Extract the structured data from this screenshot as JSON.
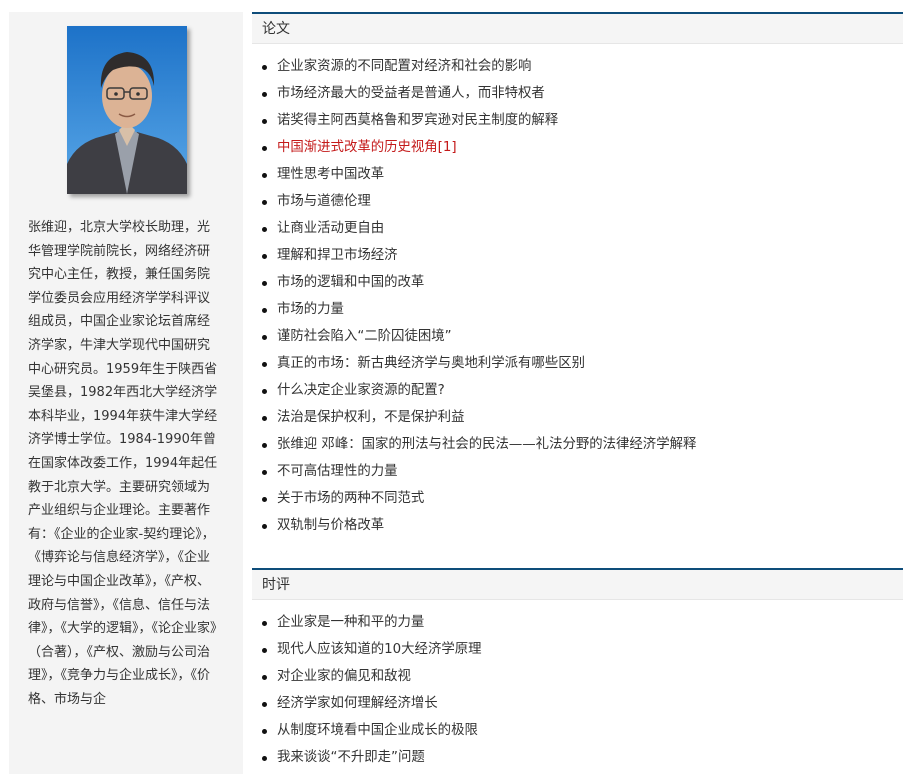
{
  "profile": {
    "portrait_alt": "张维迎",
    "bio": "张维迎，北京大学校长助理，光华管理学院前院长，网络经济研究中心主任，教授，兼任国务院学位委员会应用经济学学科评议组成员，中国企业家论坛首席经济学家，牛津大学现代中国研究中心研究员。1959年生于陕西省吴堡县，1982年西北大学经济学本科毕业，1994年获牛津大学经济学博士学位。1984-1990年曾在国家体改委工作，1994年起任教于北京大学。主要研究领域为产业组织与企业理论。主要著作有：《企业的企业家-契约理论》，《博弈论与信息经济学》，《企业理论与中国企业改革》，《产权、政府与信誉》，《信息、信任与法律》，《大学的逻辑》，《论企业家》（合著），《产权、激励与公司治理》，《竞争力与企业成长》，《价格、市场与企"
  },
  "papers": {
    "title": "论文",
    "items": [
      "企业家资源的不同配置对经济和社会的影响",
      "市场经济最大的受益者是普通人，而非特权者",
      "诺奖得主阿西莫格鲁和罗宾逊对民主制度的解释",
      "中国渐进式改革的历史视角[1]",
      "理性思考中国改革",
      "市场与道德伦理",
      "让商业活动更自由",
      "理解和捍卫市场经济",
      "市场的逻辑和中国的改革",
      "市场的力量",
      "谨防社会陷入“二阶囚徒困境”",
      "真正的市场：新古典经济学与奥地利学派有哪些区别",
      "什么决定企业家资源的配置?",
      "法治是保护权利，不是保护利益",
      "张维迎 邓峰：国家的刑法与社会的民法——礼法分野的法律经济学解释",
      "不可高估理性的力量",
      "关于市场的两种不同范式",
      "双轨制与价格改革"
    ]
  },
  "commentary": {
    "title": "时评",
    "items": [
      "企业家是一种和平的力量",
      "现代人应该知道的10大经济学原理",
      "对企业家的偏见和敌视",
      "经济学家如何理解经济增长",
      "从制度环境看中国企业成长的极限",
      "我来谈谈“不升即走”问题"
    ]
  },
  "colors": {
    "header_border": "#0e4d7a",
    "highlight_link": "#c41a1a",
    "sidebar_bg": "#f4f4f4"
  }
}
